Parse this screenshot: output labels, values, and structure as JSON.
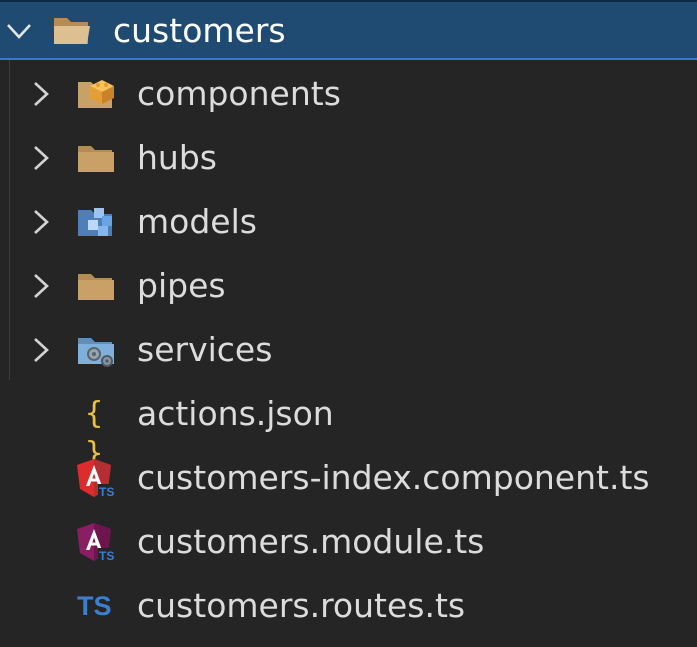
{
  "root": {
    "label": "customers",
    "icon": "folder-open-icon"
  },
  "folders": [
    {
      "label": "components",
      "icon": "folder-components-icon",
      "color": "#e39e35"
    },
    {
      "label": "hubs",
      "icon": "folder-icon",
      "color": "#c9a167"
    },
    {
      "label": "models",
      "icon": "folder-models-icon",
      "color": "#4e8fdc"
    },
    {
      "label": "pipes",
      "icon": "folder-icon",
      "color": "#c9a167"
    },
    {
      "label": "services",
      "icon": "folder-services-icon",
      "color": "#6fa3cf"
    }
  ],
  "files": [
    {
      "label": "actions.json",
      "icon": "json-icon",
      "glyph": "{ }"
    },
    {
      "label": "customers-index.component.ts",
      "icon": "angular-component-icon",
      "color": "#dd2c2c"
    },
    {
      "label": "customers.module.ts",
      "icon": "angular-module-icon",
      "color": "#8a1e63"
    },
    {
      "label": "customers.routes.ts",
      "icon": "typescript-icon",
      "glyph": "TS"
    }
  ],
  "colors": {
    "background": "#252526",
    "selection": "#1f4a72",
    "selection_border": "#2f7cd0",
    "text": "#dcdcdc",
    "ts_blue": "#3d7fcf"
  }
}
